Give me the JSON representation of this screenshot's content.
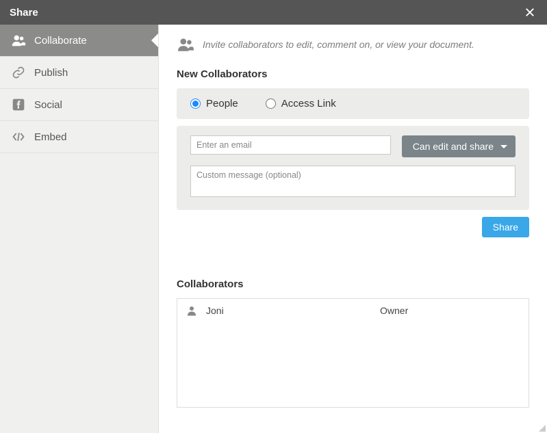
{
  "header": {
    "title": "Share"
  },
  "sidebar": {
    "tabs": [
      {
        "label": "Collaborate"
      },
      {
        "label": "Publish"
      },
      {
        "label": "Social"
      },
      {
        "label": "Embed"
      }
    ]
  },
  "intro": {
    "text": "Invite collaborators to edit, comment on, or view your document."
  },
  "newCollab": {
    "heading": "New Collaborators",
    "radio": {
      "people": "People",
      "accessLink": "Access Link"
    },
    "emailPlaceholder": "Enter an email",
    "permission": "Can edit and share",
    "msgPlaceholder": "Custom message (optional)",
    "shareBtn": "Share"
  },
  "collaborators": {
    "heading": "Collaborators",
    "rows": [
      {
        "name": "Joni",
        "role": "Owner"
      }
    ]
  }
}
